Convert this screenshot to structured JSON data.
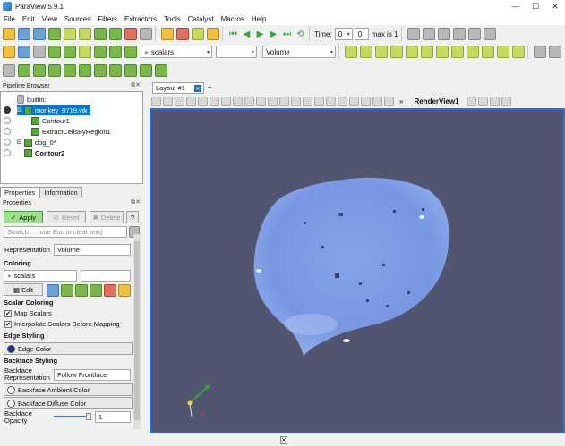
{
  "window": {
    "title": "ParaView 5.9.1",
    "minimize": "—",
    "maximize": "☐",
    "close": "✕"
  },
  "menu": [
    "File",
    "Edit",
    "View",
    "Sources",
    "Filters",
    "Extractors",
    "Tools",
    "Catalyst",
    "Macros",
    "Help"
  ],
  "toolbar": {
    "time_label": "Time:",
    "time_value": "0",
    "timestep_value": "0",
    "max_label": "max is 1",
    "color_array": "scalars",
    "component": "",
    "representation": "Volume"
  },
  "pipeline": {
    "title": "Pipeline Browser",
    "items": [
      {
        "label": "builtin:",
        "level": 0,
        "visible": null
      },
      {
        "label": "monkey_0719.vtk",
        "level": 1,
        "visible": true,
        "selected": true
      },
      {
        "label": "Contour1",
        "level": 2,
        "visible": false
      },
      {
        "label": "ExtractCellsByRegion1",
        "level": 2,
        "visible": false
      },
      {
        "label": "dog_0*",
        "level": 1,
        "visible": false
      },
      {
        "label": "Contour2",
        "level": 2,
        "visible": false,
        "bold": true
      }
    ]
  },
  "tabs": [
    "Properties",
    "Information"
  ],
  "properties": {
    "title": "Properties",
    "apply": "Apply",
    "reset": "Reset",
    "delete": "Delete",
    "help": "?",
    "search_placeholder": "Search ... (use Esc to clear text)",
    "representation_label": "Representation",
    "representation_value": "Volume",
    "coloring_section": "Coloring",
    "coloring_value": "scalars",
    "edit_label": "Edit",
    "scalar_coloring_section": "Scalar Coloring",
    "map_scalars": "Map Scalars",
    "interpolate": "Interpolate Scalars Before Mapping",
    "edge_styling_section": "Edge Styling",
    "edge_color": "Edge Color",
    "backface_section": "Backface Styling",
    "backface_rep_label": "Backface Representation",
    "backface_rep_value": "Follow Frontface",
    "backface_ambient": "Backface Ambient Color",
    "backface_diffuse": "Backface Diffuse Color",
    "backface_opacity_label": "Backface Opacity",
    "backface_opacity_value": "1"
  },
  "layout": {
    "tab": "Layout #1",
    "add_tab": "+",
    "view_name": "RenderView1"
  },
  "colors": {
    "viewport_bg": "#52556f",
    "volume": "#7f9fea",
    "accent": "#2a72d8"
  }
}
